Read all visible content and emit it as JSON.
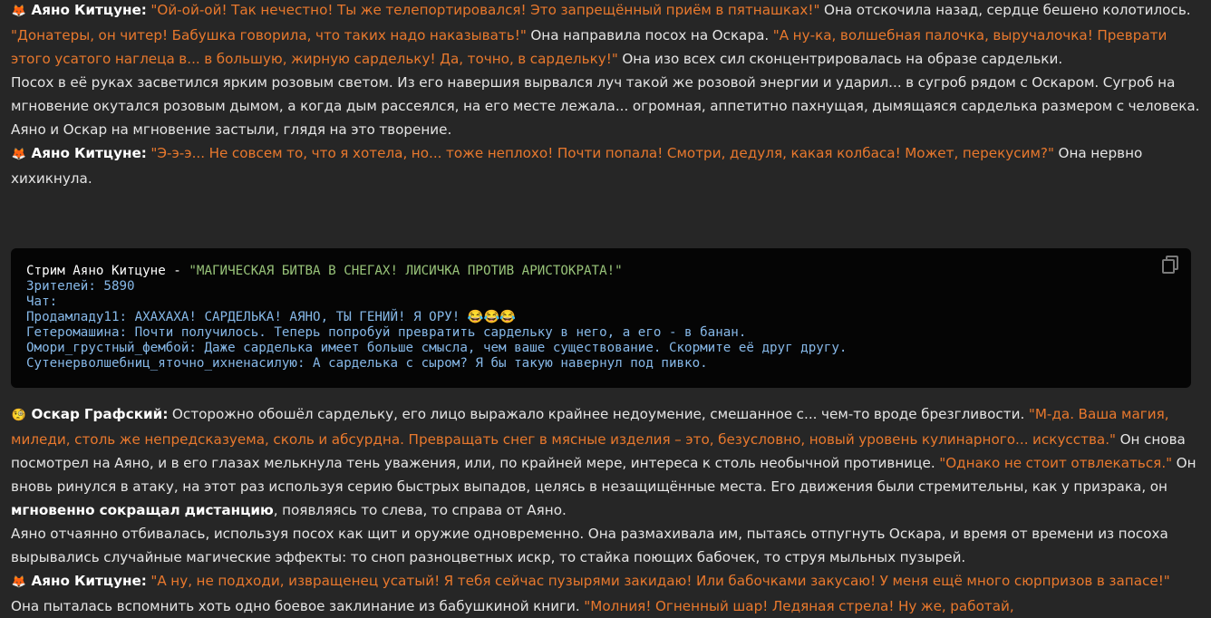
{
  "chat": {
    "p1": {
      "emoji": "🦊",
      "speaker": "Аяно Китцуне:",
      "q1": "\"Ой-ой-ой! Так нечестно! Ты же телепортировался! Это запрещённый приём в пятнашках!\"",
      "t1": " Она отскочила назад, сердце бешено колотилось. ",
      "q2": "\"Донатеры, он читер! Бабушка говорила, что таких надо наказывать!\"",
      "t2": " Она направила посох на Оскара. ",
      "q3": "\"А ну-ка, волшебная палочка, выручалочка! Преврати этого усатого наглеца в... в большую, жирную сардельку! Да, точно, в сардельку!\"",
      "t3": " Она изо всех сил сконцентрировалась на образе сардельки."
    },
    "p2": "Посох в её руках засветился ярким розовым светом. Из его навершия вырвался луч такой же розовой энергии и ударил... в сугроб рядом с Оскаром. Сугроб на мгновение окутался розовым дымом, а когда дым рассеялся, на его месте лежала... огромная, аппетитно пахнущая, дымящаяся сарделька размером с человека.",
    "p3": "Аяно и Оскар на мгновение застыли, глядя на это творение.",
    "p4": {
      "emoji": "🦊",
      "speaker": "Аяно Китцуне:",
      "q1": "\"Э-э-э... Не совсем то, что я хотела, но... тоже неплохо! Почти попала! Смотри, дедуля, какая колбаса! Может, перекусим?\"",
      "t1": " Она нервно хихикнула."
    },
    "code": {
      "title": "Стрим Аяно Китцуне - ",
      "title_str": "\"МАГИЧЕСКАЯ БИТВА В СНЕГАХ! ЛИСИЧКА ПРОТИВ АРИСТОКРАТА!\"",
      "viewers": "Зрителей: 5890",
      "chat_label": "Чат:",
      "m1": "Продамладу11: АХАХАХА! САРДЕЛЬКА! АЯНО, ТЫ ГЕНИЙ! Я ОРУ! 😂😂😂",
      "m2": "Гетеромашина: Почти получилось. Теперь попробуй превратить сардельку в него, а его - в банан.",
      "m3": "Омори_грустный_фембой: Даже сарделька имеет больше смысла, чем ваше существование. Скормите её друг другу.",
      "m4": "Сутенерволшебниц_яточно_ихненасилую: А сарделька с сыром? Я бы такую навернул под пивко."
    },
    "p5": {
      "emoji": "🧐",
      "speaker": "Оскар Графский:",
      "t1": " Осторожно обошёл сардельку, его лицо выражало крайнее недоумение, смешанное с... чем-то вроде брезгливости. ",
      "q1": "\"М-да. Ваша магия, миледи, столь же непредсказуема, сколь и абсурдна. Превращать снег в мясные изделия – это, безусловно, новый уровень кулинарного... искусства.\"",
      "t2": " Он снова посмотрел на Аяно, и в его глазах мелькнула тень уважения, или, по крайней мере, интереса к столь необычной противнице. ",
      "q2": "\"Однако не стоит отвлекаться.\"",
      "t3": " Он вновь ринулся в атаку, на этот раз используя серию быстрых выпадов, целясь в незащищённые места. Его движения были стремительны, как у призрака, он ",
      "strong": "мгновенно сокращал дистанцию",
      "t4": ", появляясь то слева, то справа от Аяно."
    },
    "p6": "Аяно отчаянно отбивалась, используя посох как щит и оружие одновременно. Она размахивала им, пытаясь отпугнуть Оскара, и время от времени из посоха вырывались случайные магические эффекты: то сноп разноцветных искр, то стайка поющих бабочек, то струя мыльных пузырей.",
    "p7": {
      "emoji": "🦊",
      "speaker": "Аяно Китцуне:",
      "q1": "\"А ну, не подходи, извращенец усатый! Я тебя сейчас пузырями закидаю! Или бабочками закусаю! У меня ещё много сюрпризов в запасе!\"",
      "t1": " Она пыталась вспомнить хоть одно боевое заклинание из бабушкиной книги. ",
      "q2": "\"Молния! Огненный шар! Ледяная стрела! Ну же, работай,"
    }
  }
}
